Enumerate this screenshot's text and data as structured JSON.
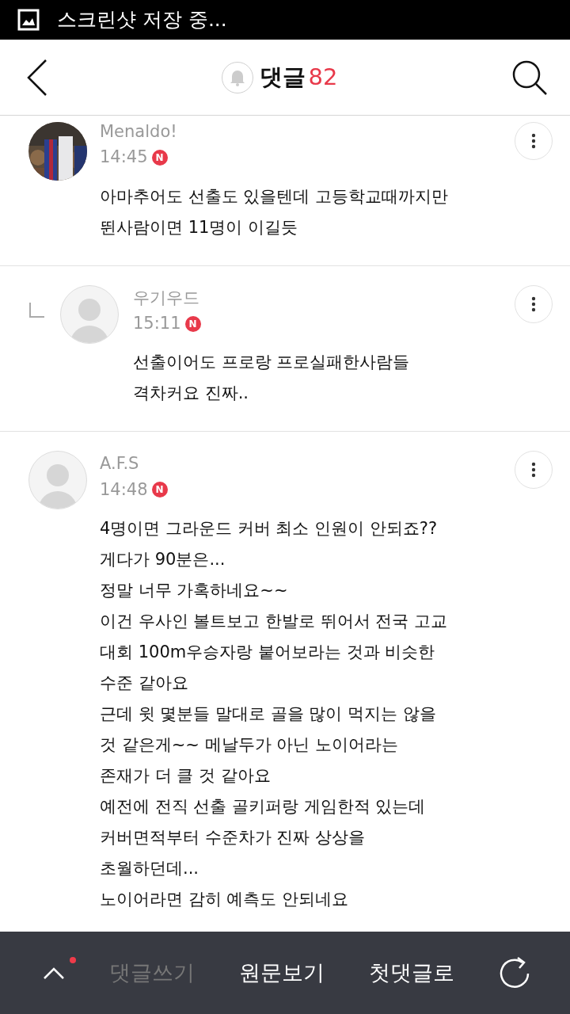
{
  "status_bar": {
    "notification": "스크린샷 저장 중..."
  },
  "header": {
    "title": "댓글",
    "count": "82"
  },
  "comments": [
    {
      "kind": "comment",
      "has_photo": true,
      "name": "Menaldo!",
      "time": "14:45",
      "new_badge": "N",
      "body": "아마추어도 선출도 있을텐데 고등학교때까지만\n뛴사람이면 11명이 이길듯"
    },
    {
      "kind": "reply",
      "has_photo": false,
      "name": "우기우드",
      "time": "15:11",
      "new_badge": "N",
      "body": "선출이어도 프로랑 프로실패한사람들\n격차커요 진짜.."
    },
    {
      "kind": "comment",
      "has_photo": false,
      "name": "A.F.S",
      "time": "14:48",
      "new_badge": "N",
      "body": "4명이면 그라운드 커버 최소 인원이 안되죠??\n게다가 90분은...\n정말 너무 가혹하네요~~\n이건 우사인 볼트보고 한발로 뛰어서 전국 고교\n대회 100m우승자랑 붙어보라는 것과 비슷한\n수준 같아요\n근데 윗 몇분들 말대로 골을 많이 먹지는 않을\n것 같은게~~ 메날두가 아닌 노이어라는\n존재가 더 클 것 같아요\n예전에 전직 선출 골키퍼랑 게임한적 있는데\n커버면적부터 수준차가 진짜 상상을\n초월하던데...\n노이어라면 감히 예측도 안되네요"
    }
  ],
  "bottom_bar": {
    "has_notification": true,
    "buttons": [
      {
        "label": "댓글쓰기",
        "disabled": true
      },
      {
        "label": "원문보기",
        "disabled": false
      },
      {
        "label": "첫댓글로",
        "disabled": false
      }
    ]
  }
}
